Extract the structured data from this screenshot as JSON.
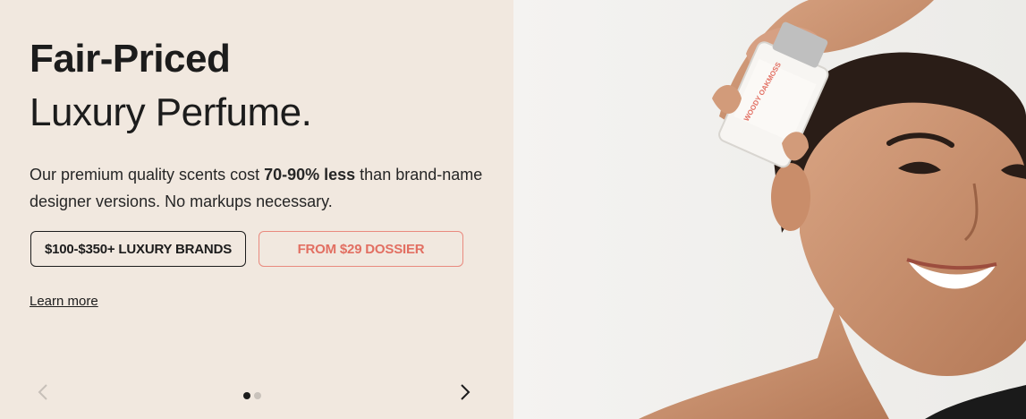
{
  "hero": {
    "title_bold": "Fair-Priced",
    "title_light": "Luxury Perfume.",
    "desc_prefix": "Our premium quality scents cost ",
    "desc_highlight": "70-90% less",
    "desc_suffix": " than brand-name designer versions. No markups necessary.",
    "button_luxury": "$100-$350+ LUXURY BRANDS",
    "button_dossier": "FROM $29 DOSSIER",
    "learn_more": "Learn more",
    "bottle_label": "WOODY OAKMOSS"
  },
  "carousel": {
    "slide_count": 2,
    "active_index": 0
  },
  "colors": {
    "panel_bg": "#f1e8df",
    "accent": "#e26f62",
    "text": "#1c1c1c"
  }
}
